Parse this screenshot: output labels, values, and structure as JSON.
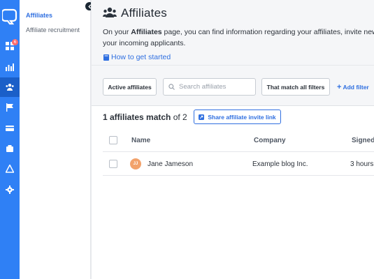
{
  "rail": {
    "notification_count": "6"
  },
  "subnav": {
    "items": [
      {
        "label": "Affiliates"
      },
      {
        "label": "Affiliate recruitment"
      }
    ]
  },
  "page": {
    "title": "Affiliates",
    "description_prefix": "On your ",
    "description_bold": "Affiliates",
    "description_suffix": " page, you can find information regarding your affiliates, invite new o",
    "description_line2": "your incoming applicants.",
    "how_to_link": "How to get started"
  },
  "filters": {
    "active_button": "Active affiliates",
    "search_placeholder": "Search affiliates",
    "match_button": "That match all filters",
    "add_filter": "Add filter"
  },
  "results": {
    "count_bold": "1 affiliates match",
    "count_rest": " of 2",
    "invite_button": "Share affiliate invite link"
  },
  "table": {
    "headers": [
      "Name",
      "Company",
      "Signed"
    ],
    "rows": [
      {
        "initials": "JJ",
        "name": "Jane Jameson",
        "company": "Example blog Inc.",
        "signed": "3 hours"
      }
    ]
  },
  "colors": {
    "accent": "#2f6fe0",
    "rail": "#2f80f5",
    "avatar": "#f2a26b",
    "badge": "#ff6b6b"
  }
}
